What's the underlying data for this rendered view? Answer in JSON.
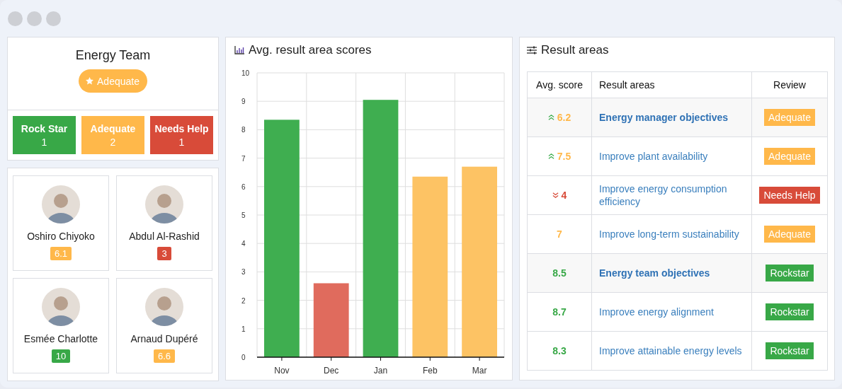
{
  "team": {
    "name": "Energy Team",
    "rating": {
      "label": "Adequate",
      "color": "#ffb84a"
    },
    "summary": [
      {
        "label": "Rock Star",
        "count": "1",
        "color": "#38a847"
      },
      {
        "label": "Adequate",
        "count": "2",
        "color": "#ffb84a"
      },
      {
        "label": "Needs Help",
        "count": "1",
        "color": "#d84b39"
      }
    ]
  },
  "members": [
    {
      "name": "Oshiro Chiyoko",
      "score": "6.1",
      "color": "#ffb84a"
    },
    {
      "name": "Abdul Al-Rashid",
      "score": "3",
      "color": "#d84b39"
    },
    {
      "name": "Esmée Charlotte",
      "score": "10",
      "color": "#38a847"
    },
    {
      "name": "Arnaud Dupéré",
      "score": "6.6",
      "color": "#ffb84a"
    }
  ],
  "chart_panel": {
    "title": "Avg. result area scores",
    "chart_data": {
      "type": "bar",
      "categories": [
        "Nov",
        "Dec",
        "Jan",
        "Feb",
        "Mar"
      ],
      "series": [
        {
          "color": "#3fae50",
          "values": [
            8.35,
            null,
            9.05,
            null,
            null
          ]
        },
        {
          "color": "#e06b5d",
          "values": [
            null,
            2.6,
            null,
            null,
            null
          ]
        },
        {
          "color": "#fdc364",
          "values": [
            null,
            null,
            null,
            6.35,
            6.7
          ]
        }
      ],
      "grid": true,
      "ylim": [
        0,
        10
      ],
      "yticks": [
        0,
        1,
        2,
        3,
        4,
        5,
        6,
        7,
        8,
        9,
        10
      ]
    }
  },
  "result_areas": {
    "title": "Result areas",
    "columns": [
      "Avg. score",
      "Result areas",
      "Review"
    ],
    "rows": [
      {
        "score": "6.2",
        "kind": "rising",
        "group": true,
        "name": "Energy manager objectives",
        "review": "Adequate",
        "color": "#ffb84a"
      },
      {
        "score": "7.5",
        "kind": "rising",
        "group": false,
        "name": "Improve plant availability",
        "review": "Adequate",
        "color": "#ffb84a"
      },
      {
        "score": "4",
        "kind": "falling",
        "group": false,
        "name": "Improve energy consumption efficiency",
        "review": "Needs Help",
        "color": "#d84b39"
      },
      {
        "score": "7",
        "kind": "plain",
        "group": false,
        "name": "Improve long-term sustainability",
        "review": "Adequate",
        "color": "#ffb84a"
      },
      {
        "score": "8.5",
        "kind": "plain",
        "group": true,
        "name": "Energy team objectives",
        "review": "Rockstar",
        "color": "#38a847"
      },
      {
        "score": "8.7",
        "kind": "plain",
        "group": false,
        "name": "Improve energy alignment",
        "review": "Rockstar",
        "color": "#38a847"
      },
      {
        "score": "8.3",
        "kind": "plain",
        "group": false,
        "name": "Improve attainable energy levels",
        "review": "Rockstar",
        "color": "#38a847"
      }
    ]
  }
}
